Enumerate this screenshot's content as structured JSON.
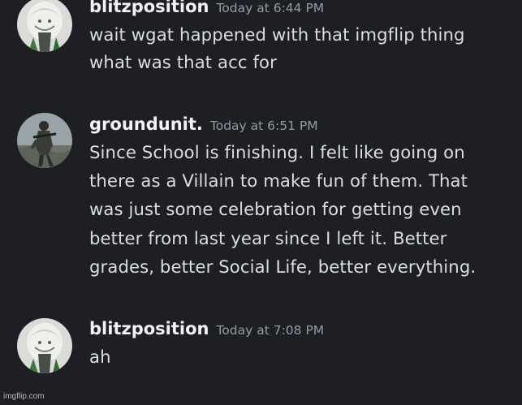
{
  "messages": [
    {
      "username": "blitzposition",
      "timestamp": "Today at 6:44 PM",
      "avatar_icon": "anime-character-avatar",
      "lines": [
        "wait wgat happened with that imgflip thing",
        "what was that acc for"
      ]
    },
    {
      "username": "groundunit.",
      "timestamp": "Today at 6:51 PM",
      "avatar_icon": "soldier-avatar",
      "lines": [
        "Since School is finishing. I felt like going on",
        "there as a Villain to make fun of them. That",
        "was just some celebration for getting even",
        "better from last year since I left it. Better",
        "grades, better Social Life, better everything."
      ]
    },
    {
      "username": "blitzposition",
      "timestamp": "Today at 7:08 PM",
      "avatar_icon": "anime-character-avatar",
      "lines": [
        "ah"
      ]
    }
  ],
  "watermark": "imgflip.com",
  "colors": {
    "background": "#1e1f24",
    "username": "#f2f3f5",
    "timestamp": "#949ba4",
    "message_text": "#dbdee1"
  }
}
